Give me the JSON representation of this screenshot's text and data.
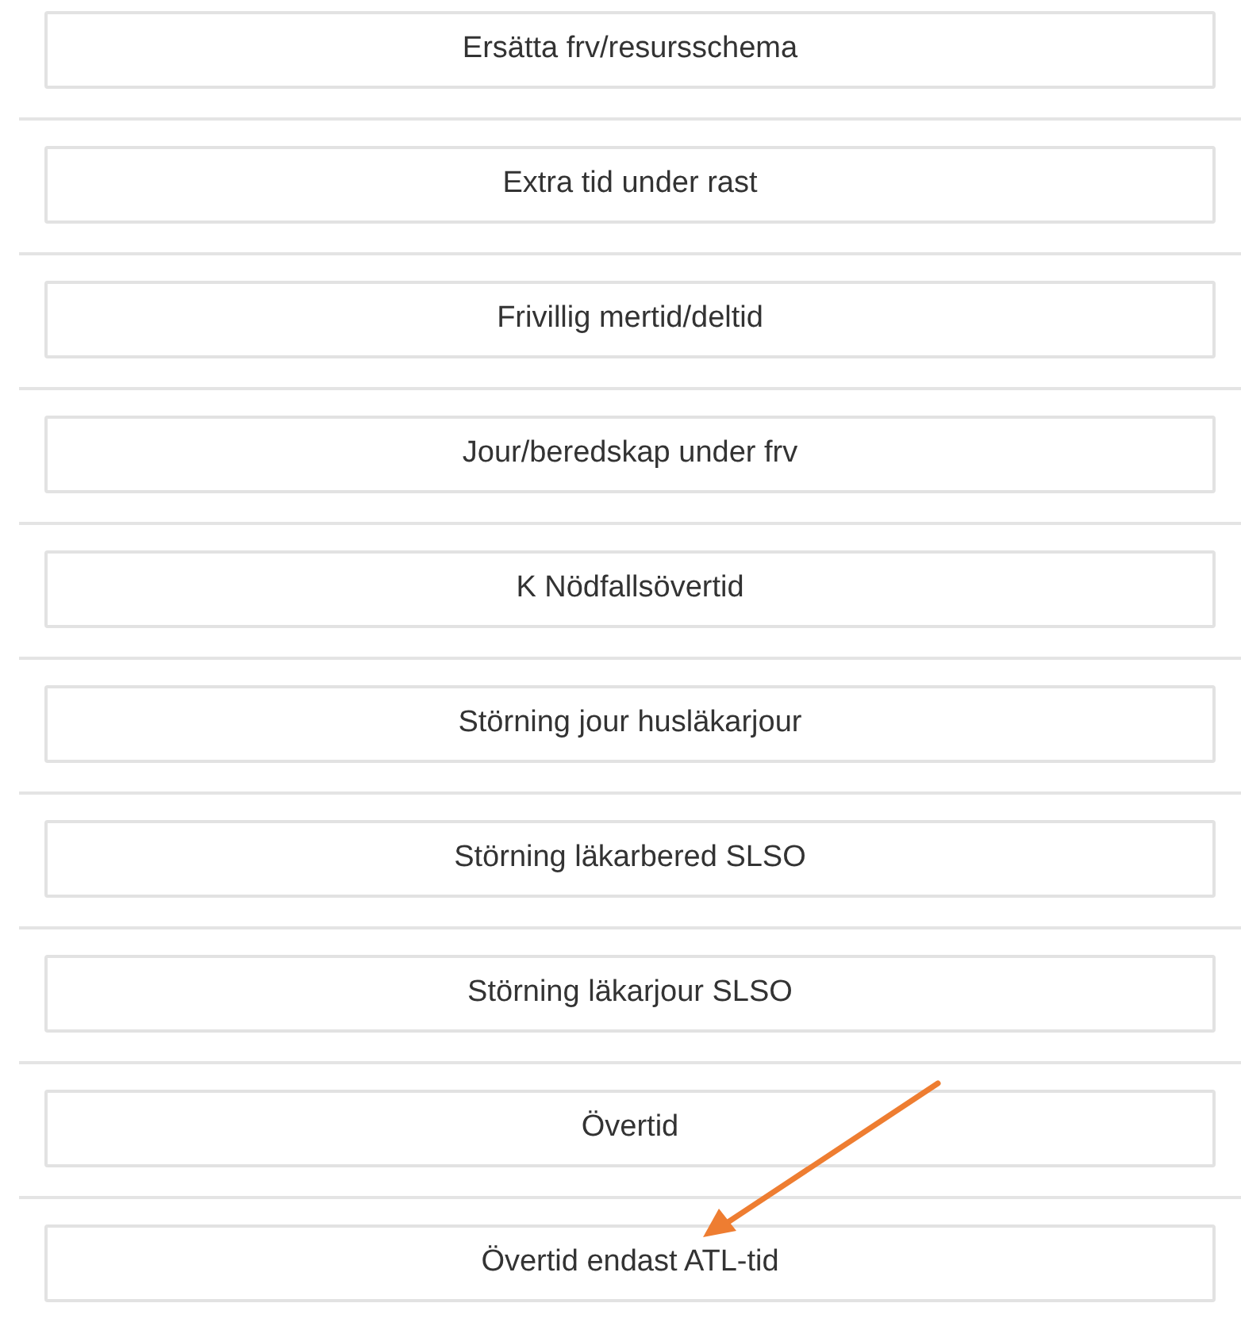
{
  "options": [
    {
      "label": "Ersätta frv/resursschema"
    },
    {
      "label": "Extra tid under rast"
    },
    {
      "label": "Frivillig mertid/deltid"
    },
    {
      "label": "Jour/beredskap under frv"
    },
    {
      "label": "K Nödfallsövertid"
    },
    {
      "label": "Störning jour husläkarjour"
    },
    {
      "label": "Störning läkarbered SLSO"
    },
    {
      "label": "Störning läkarjour SLSO"
    },
    {
      "label": "Övertid"
    },
    {
      "label": "Övertid endast ATL-tid"
    }
  ]
}
